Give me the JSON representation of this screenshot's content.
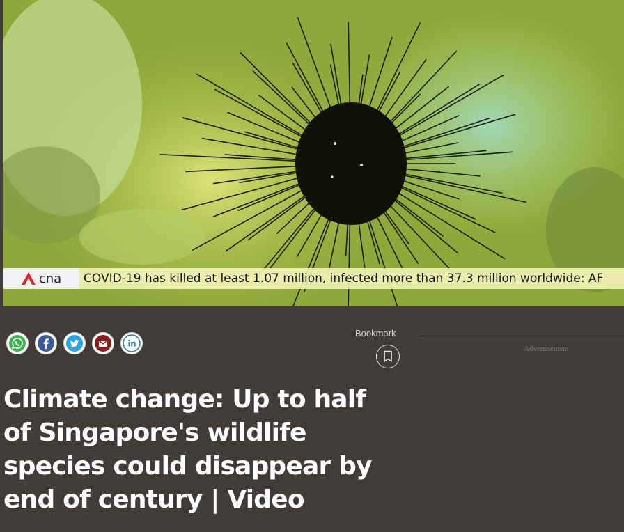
{
  "video": {
    "channel_logo": "cna",
    "ticker": "COVID-19 has killed at least 1.07 million, infected more than 37.3 million worldwide: AF"
  },
  "share": [
    {
      "name": "whatsapp-share-button",
      "icon": "whatsapp-icon",
      "color": "#3bb44a"
    },
    {
      "name": "facebook-share-button",
      "icon": "facebook-icon",
      "color": "#3b5a98"
    },
    {
      "name": "twitter-share-button",
      "icon": "twitter-icon",
      "color": "#2aa3e0"
    },
    {
      "name": "email-share-button",
      "icon": "mail-icon",
      "color": "#8e1c1c"
    },
    {
      "name": "linkedin-share-button",
      "icon": "linkedin-icon",
      "color": "#2a77b0"
    }
  ],
  "bookmark": {
    "label": "Bookmark"
  },
  "ad": {
    "label": "Advertisement"
  },
  "article": {
    "title": "Climate change: Up to half of Singapore's wildlife species could disappear by end of century | Video"
  },
  "colors": {
    "background": "#413b39",
    "ticker_bg": "#f2f2b4",
    "logo_red": "#d6282b"
  }
}
